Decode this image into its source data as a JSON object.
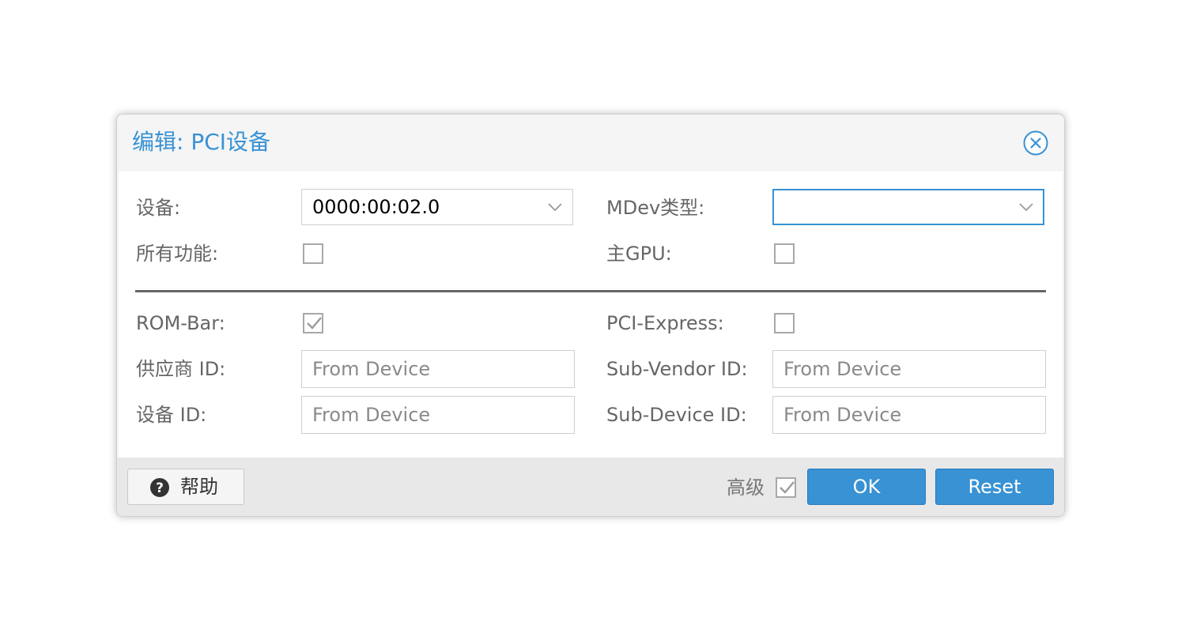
{
  "dialog": {
    "title": "编辑: PCI设备"
  },
  "form": {
    "device": {
      "label": "设备:",
      "value": "0000:00:02.0"
    },
    "mdev_type": {
      "label": "MDev类型:",
      "value": ""
    },
    "all_functions": {
      "label": "所有功能:",
      "checked": false
    },
    "primary_gpu": {
      "label": "主GPU:",
      "checked": false
    },
    "rom_bar": {
      "label": "ROM-Bar:",
      "checked": true
    },
    "pci_express": {
      "label": "PCI-Express:",
      "checked": false
    },
    "vendor_id": {
      "label": "供应商 ID:",
      "placeholder": "From Device"
    },
    "sub_vendor_id": {
      "label": "Sub-Vendor ID:",
      "placeholder": "From Device"
    },
    "device_id": {
      "label": "设备 ID:",
      "placeholder": "From Device"
    },
    "sub_device_id": {
      "label": "Sub-Device ID:",
      "placeholder": "From Device"
    }
  },
  "footer": {
    "help_label": "帮助",
    "advanced_label": "高级",
    "advanced_checked": true,
    "ok_label": "OK",
    "reset_label": "Reset"
  },
  "colors": {
    "accent": "#3892d4",
    "label_text": "#666666",
    "border": "#cfcfcf"
  },
  "icons": {
    "close": "close-circle-icon",
    "dropdown": "chevron-down-icon",
    "help": "question-circle-icon",
    "check": "checkmark-icon"
  }
}
